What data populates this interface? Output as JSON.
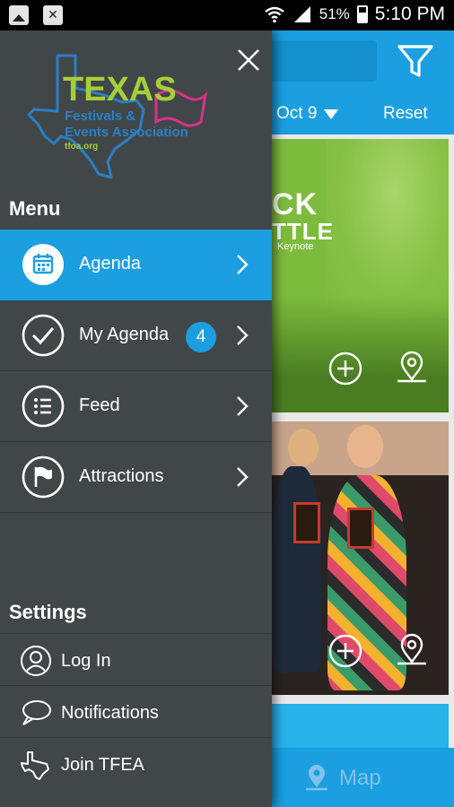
{
  "status_bar": {
    "battery": "51%",
    "time": "5:10 PM"
  },
  "app": {
    "date_filter": "Oct 9",
    "reset_label": "Reset",
    "card1": {
      "line1": "CK",
      "line2": "TTLE",
      "line3": "Keynote"
    },
    "map_label": "Map"
  },
  "drawer": {
    "menu_title": "Menu",
    "menu_items": [
      {
        "label": "Agenda",
        "icon": "calendar-icon",
        "active": true
      },
      {
        "label": "My Agenda",
        "icon": "check-circle-icon",
        "badge": "4"
      },
      {
        "label": "Feed",
        "icon": "list-icon"
      },
      {
        "label": "Attractions",
        "icon": "flag-icon"
      }
    ],
    "settings_title": "Settings",
    "settings_items": [
      {
        "label": "Log In",
        "icon": "user-icon"
      },
      {
        "label": "Notifications",
        "icon": "chat-bubble-icon"
      },
      {
        "label": "Join TFEA",
        "icon": "texas-icon"
      }
    ],
    "logo": {
      "word": "TEXAS",
      "line2": "Festivals &",
      "line3": "Events Association",
      "url": "tfoa.org"
    }
  },
  "colors": {
    "accent": "#1b9fe0",
    "drawer_bg": "#414649",
    "logo_green": "#a6ce39",
    "logo_pink": "#d6338a",
    "logo_blue": "#2b7fc4"
  }
}
